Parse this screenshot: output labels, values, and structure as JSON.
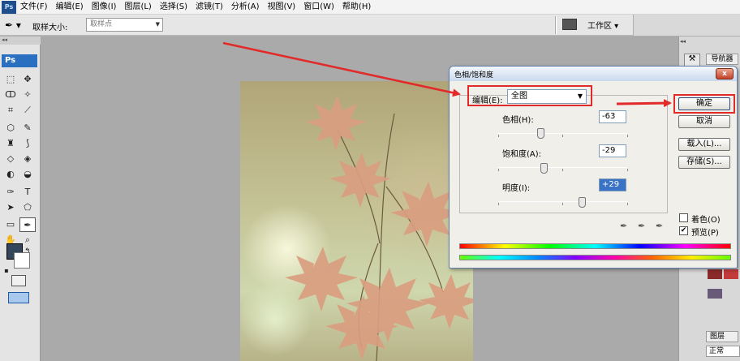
{
  "menu": {
    "logo": "Ps",
    "items": [
      "文件(F)",
      "编辑(E)",
      "图像(I)",
      "图层(L)",
      "选择(S)",
      "滤镜(T)",
      "分析(A)",
      "视图(V)",
      "窗口(W)",
      "帮助(H)"
    ]
  },
  "options_bar": {
    "sample_size_label": "取样大小:",
    "sample_size_value": "取样点",
    "workspace_label": "工作区 ▾"
  },
  "toolbox": {
    "logo": "Ps",
    "collapse": "◂◂"
  },
  "dialog": {
    "title": "色相/饱和度",
    "close": "x",
    "edit_label": "编辑(E):",
    "edit_value": "全图",
    "hue_label": "色相(H):",
    "hue_value": "-63",
    "hue_level": -63,
    "saturation_label": "饱和度(A):",
    "saturation_value": "-29",
    "saturation_level": -29,
    "lightness_label": "明度(I):",
    "lightness_value": "+29",
    "lightness_level": 29,
    "ok": "确定",
    "cancel": "取消",
    "load": "载入(L)...",
    "save": "存储(S)...",
    "colorize_label": "着色(O)",
    "colorize_checked": false,
    "preview_label": "预览(P)",
    "preview_checked": true
  },
  "dock": {
    "collapse": "◂◂",
    "navigator": "导航器",
    "layers": "图层",
    "blend_mode": "正常"
  },
  "colors": {
    "highlight": "#e22a2a",
    "foreground": "#33465c",
    "background": "#ffffff"
  }
}
